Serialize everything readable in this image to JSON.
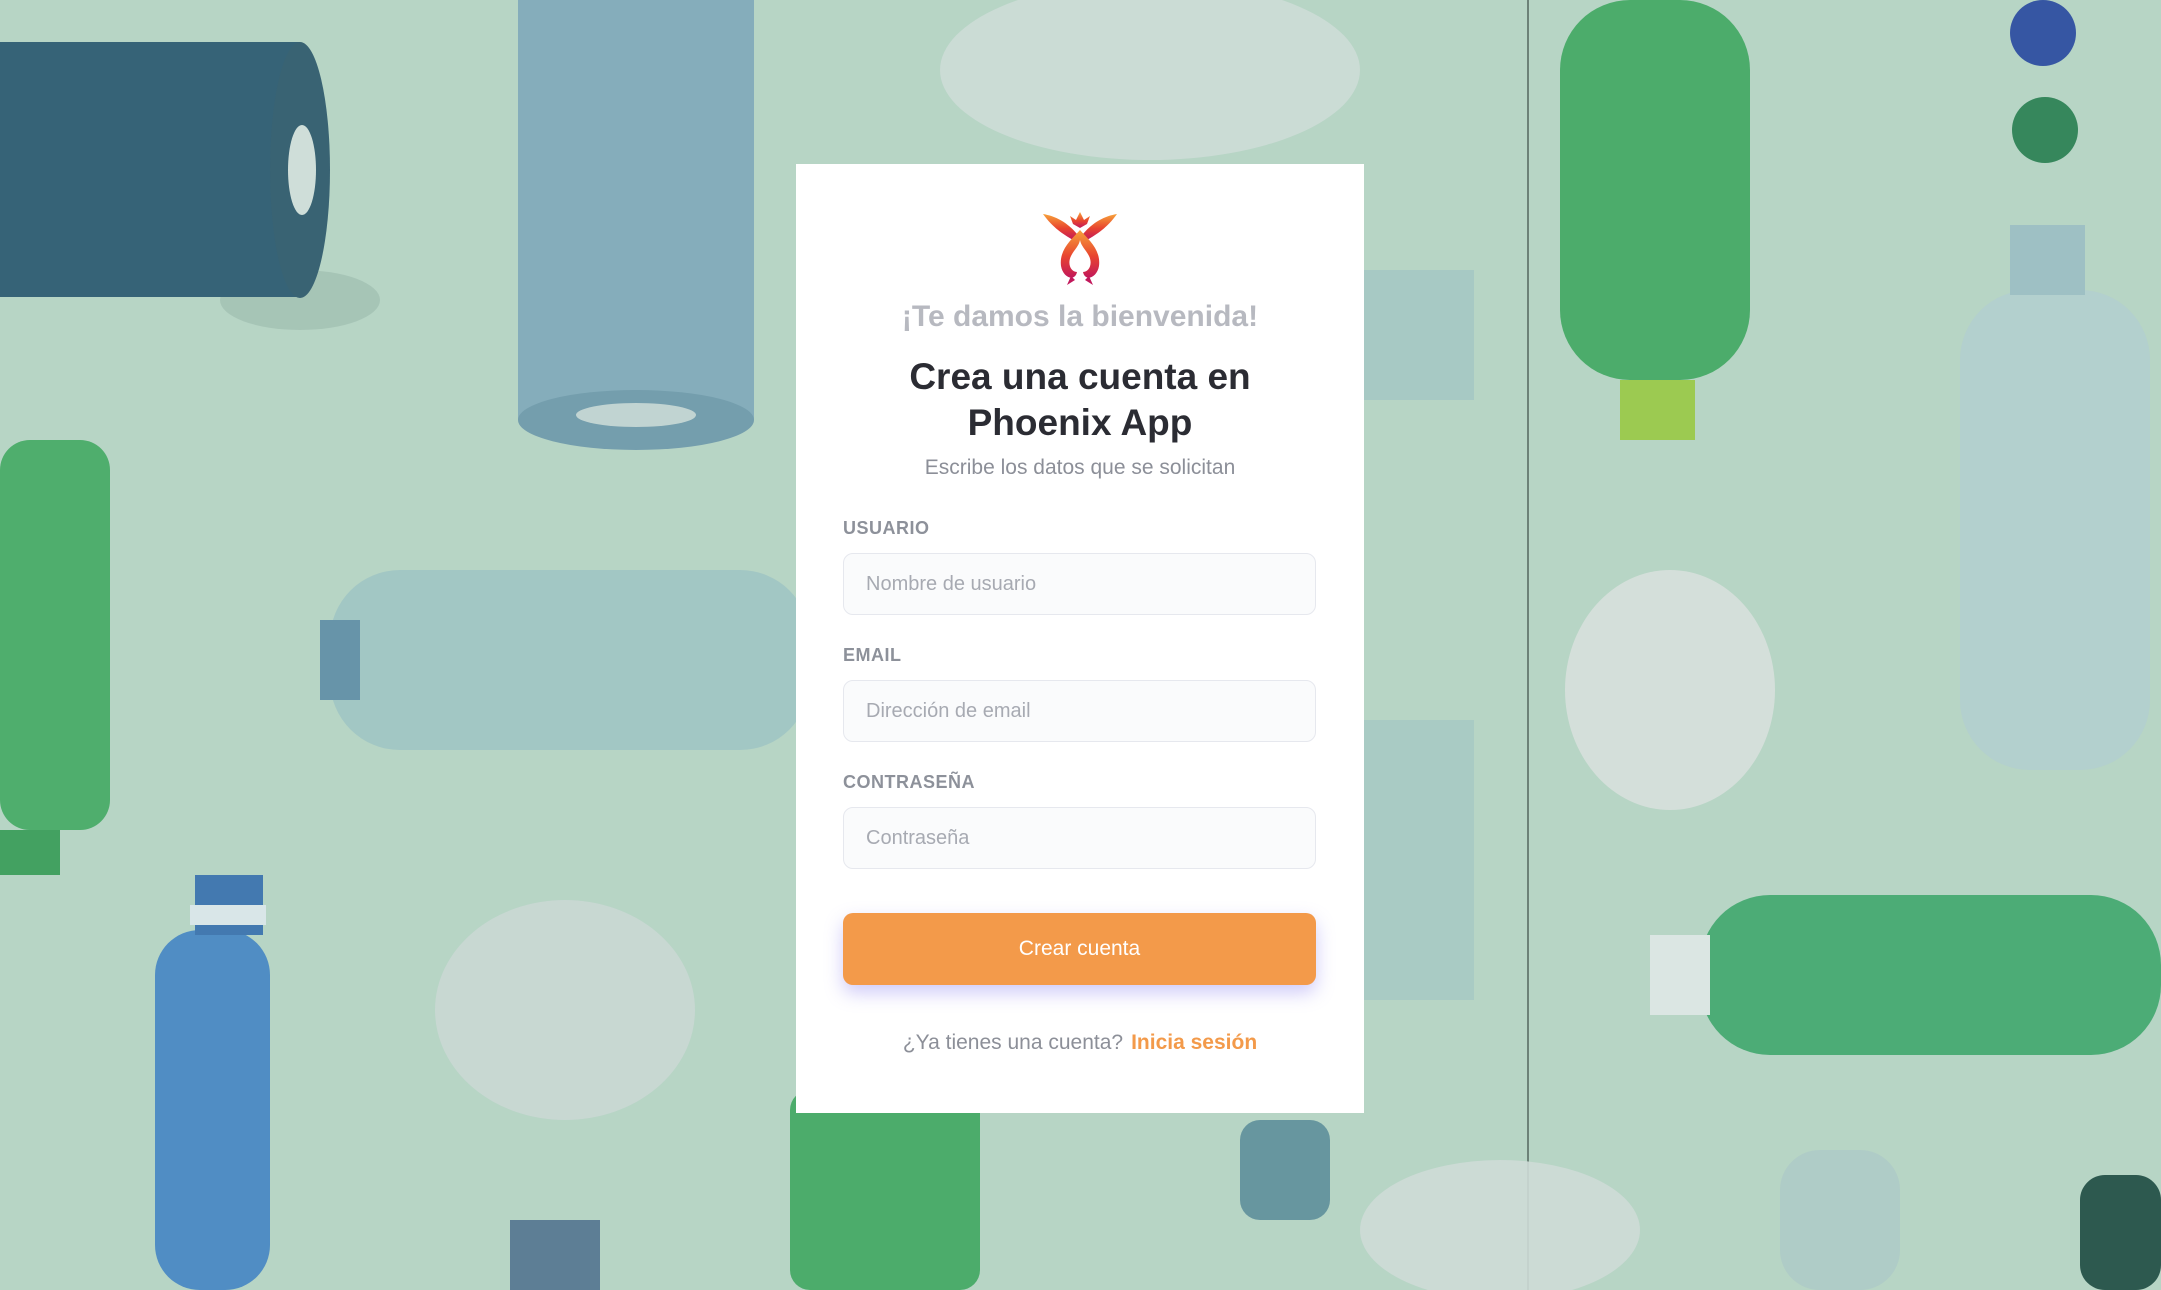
{
  "card": {
    "welcome": "¡Te damos la bienvenida!",
    "title_line1": "Crea una cuenta en",
    "title_line2": "Phoenix App",
    "subtitle": "Escribe los datos que se solicitan"
  },
  "form": {
    "username": {
      "label": "USUARIO",
      "placeholder": "Nombre de usuario",
      "value": ""
    },
    "email": {
      "label": "EMAIL",
      "placeholder": "Dirección de email",
      "value": ""
    },
    "password": {
      "label": "CONTRASEÑA",
      "placeholder": "Contraseña",
      "value": ""
    },
    "submit_label": "Crear cuenta"
  },
  "footer": {
    "prompt": "¿Ya tienes una cuenta?",
    "link_label": "Inicia sesión"
  },
  "colors": {
    "accent": "#f39a4a",
    "background": "#bcd9ca",
    "title": "#2b2c33",
    "muted": "#8c8f98"
  },
  "icons": {
    "logo": "phoenix-logo-icon"
  }
}
